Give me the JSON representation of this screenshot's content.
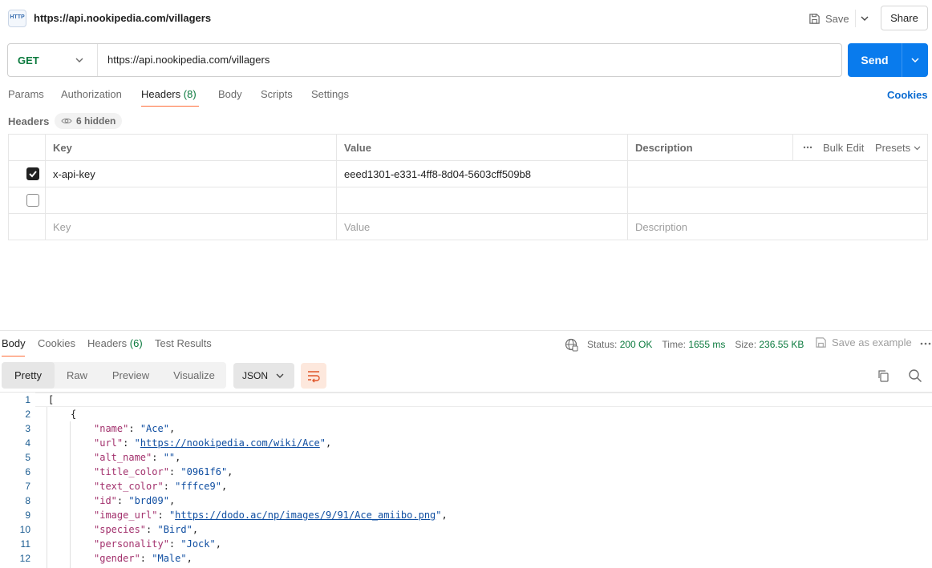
{
  "top": {
    "badge": "HTTP",
    "title": "https://api.nookipedia.com/villagers",
    "save_label": "Save",
    "share_label": "Share"
  },
  "request": {
    "method": "GET",
    "url": "https://api.nookipedia.com/villagers",
    "send_label": "Send"
  },
  "req_tabs": {
    "params": "Params",
    "authorization": "Authorization",
    "headers": "Headers",
    "headers_count": "(8)",
    "body": "Body",
    "scripts": "Scripts",
    "settings": "Settings",
    "cookies": "Cookies"
  },
  "headers_section": {
    "label": "Headers",
    "hidden": "6 hidden",
    "columns": {
      "key": "Key",
      "value": "Value",
      "description": "Description"
    },
    "bulk_edit": "Bulk Edit",
    "presets": "Presets",
    "rows": [
      {
        "checked": true,
        "key": "x-api-key",
        "value": "eeed1301-e331-4ff8-8d04-5603cff509b8",
        "description": ""
      }
    ],
    "placeholders": {
      "key": "Key",
      "value": "Value",
      "description": "Description"
    }
  },
  "response": {
    "tabs": {
      "body": "Body",
      "cookies": "Cookies",
      "headers": "Headers",
      "headers_count": "(6)",
      "test_results": "Test Results"
    },
    "status_label": "Status:",
    "status_value": "200 OK",
    "time_label": "Time:",
    "time_value": "1655 ms",
    "size_label": "Size:",
    "size_value": "236.55 KB",
    "save_example": "Save as example",
    "views": {
      "pretty": "Pretty",
      "raw": "Raw",
      "preview": "Preview",
      "visualize": "Visualize"
    },
    "format": "JSON"
  },
  "code_lines": [
    {
      "n": "1",
      "indent": 0,
      "type": "punct",
      "text": "["
    },
    {
      "n": "2",
      "indent": 1,
      "type": "punct",
      "text": "{"
    },
    {
      "n": "3",
      "indent": 2,
      "type": "kv",
      "key": "\"name\"",
      "value": "\"Ace\""
    },
    {
      "n": "4",
      "indent": 2,
      "type": "kvlink",
      "key": "\"url\"",
      "link": "https://nookipedia.com/wiki/Ace"
    },
    {
      "n": "5",
      "indent": 2,
      "type": "kv",
      "key": "\"alt_name\"",
      "value": "\"\""
    },
    {
      "n": "6",
      "indent": 2,
      "type": "kv",
      "key": "\"title_color\"",
      "value": "\"0961f6\""
    },
    {
      "n": "7",
      "indent": 2,
      "type": "kv",
      "key": "\"text_color\"",
      "value": "\"fffce9\""
    },
    {
      "n": "8",
      "indent": 2,
      "type": "kv",
      "key": "\"id\"",
      "value": "\"brd09\""
    },
    {
      "n": "9",
      "indent": 2,
      "type": "kvlink",
      "key": "\"image_url\"",
      "link": "https://dodo.ac/np/images/9/91/Ace_amiibo.png"
    },
    {
      "n": "10",
      "indent": 2,
      "type": "kv",
      "key": "\"species\"",
      "value": "\"Bird\""
    },
    {
      "n": "11",
      "indent": 2,
      "type": "kv",
      "key": "\"personality\"",
      "value": "\"Jock\""
    },
    {
      "n": "12",
      "indent": 2,
      "type": "kv",
      "key": "\"gender\"",
      "value": "\"Male\""
    }
  ],
  "colors": {
    "send": "#097bed",
    "accent_tab": "#ff6c37",
    "method": "#0b7a3e",
    "json_key": "#a2306c",
    "json_string": "#0f4ea1"
  },
  "icons": [
    "http-icon",
    "save-icon",
    "chevron-down-icon",
    "eye-icon",
    "checkmark-icon",
    "more-horizontal-icon",
    "globe-icon",
    "save-example-icon",
    "wrap-lines-icon",
    "copy-icon",
    "search-icon"
  ]
}
